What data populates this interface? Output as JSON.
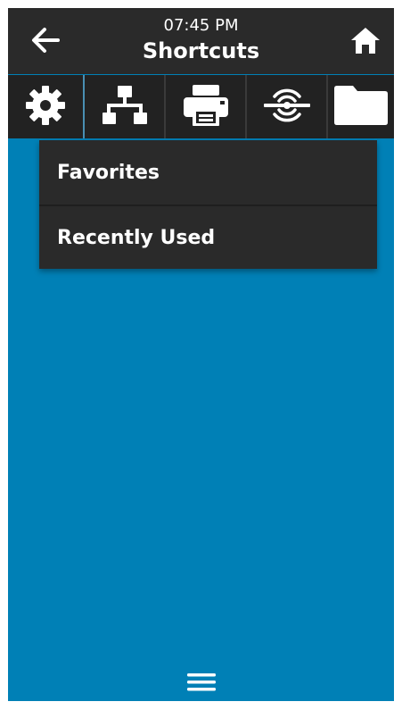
{
  "header": {
    "time": "07:45 PM",
    "title": "Shortcuts",
    "back_icon": "back-arrow-icon",
    "home_icon": "home-icon"
  },
  "tabs": [
    {
      "icon": "gear-icon"
    },
    {
      "icon": "network-icon"
    },
    {
      "icon": "printer-icon"
    },
    {
      "icon": "rfid-icon"
    },
    {
      "icon": "folder-icon"
    }
  ],
  "menu": {
    "items": [
      {
        "label": "Favorites"
      },
      {
        "label": "Recently Used"
      }
    ]
  },
  "bottom": {
    "icon": "hamburger-menu-icon"
  },
  "colors": {
    "background": "#0080b6",
    "bar": "#2a2a2a",
    "text": "#ffffff"
  }
}
